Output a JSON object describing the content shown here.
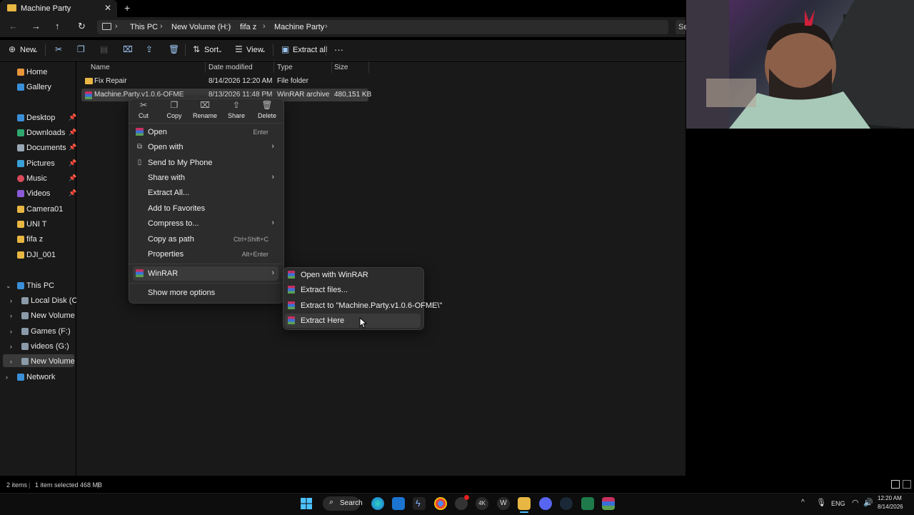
{
  "window": {
    "tab_title": "Machine Party",
    "tab_close": "✕",
    "new_tab": "+"
  },
  "nav": {
    "back": "←",
    "forward": "→",
    "up": "↑",
    "refresh": "↻"
  },
  "breadcrumb": {
    "items": [
      "This PC",
      "New Volume (H:)",
      "fifa z",
      "Machine Party"
    ],
    "chevron": "›",
    "search_stub": "Se"
  },
  "command_bar": {
    "new": "New",
    "sort": "Sort",
    "view": "View",
    "extract_all": "Extract all",
    "more": "···"
  },
  "sidebar": {
    "home": "Home",
    "gallery": "Gallery",
    "quick_access": [
      "Desktop",
      "Downloads",
      "Documents",
      "Pictures",
      "Music",
      "Videos",
      "Camera01",
      "UNI T",
      "fifa z",
      "DJI_001"
    ],
    "this_pc": "This PC",
    "drives": [
      "Local Disk (C:)",
      "New Volume (E:)",
      "Games (F:)",
      "videos (G:)",
      "New Volume (H:)"
    ],
    "network": "Network"
  },
  "file_list": {
    "headers": [
      "Name",
      "Date modified",
      "Type",
      "Size"
    ],
    "rows": [
      {
        "name": "Fix Repair",
        "date": "8/14/2026 12:20 AM",
        "type": "File folder",
        "size": ""
      },
      {
        "name": "Machine.Party.v1.0.6-OFME",
        "date": "8/13/2026 11:48 PM",
        "type": "WinRAR archive",
        "size": "480,151 KB"
      }
    ]
  },
  "status_bar": {
    "items": "2 items",
    "selected": "1 item selected  468 MB"
  },
  "context_menu": {
    "quick_actions": [
      "Cut",
      "Copy",
      "Rename",
      "Share",
      "Delete"
    ],
    "items": [
      {
        "label": "Open",
        "shortcut": "Enter"
      },
      {
        "label": "Open with",
        "shortcut": ""
      },
      {
        "label": "Send to My Phone",
        "shortcut": ""
      },
      {
        "label": "Share with",
        "shortcut": ""
      },
      {
        "label": "Extract All...",
        "shortcut": ""
      },
      {
        "label": "Add to Favorites",
        "shortcut": ""
      },
      {
        "label": "Compress to...",
        "shortcut": ""
      },
      {
        "label": "Copy as path",
        "shortcut": "Ctrl+Shift+C"
      },
      {
        "label": "Properties",
        "shortcut": "Alt+Enter"
      },
      {
        "label": "WinRAR",
        "shortcut": ""
      },
      {
        "label": "Show more options",
        "shortcut": ""
      }
    ]
  },
  "winrar_submenu": {
    "items": [
      "Open with WinRAR",
      "Extract files...",
      "Extract to \"Machine.Party.v1.0.6-OFME\\\"",
      "Extract Here"
    ]
  },
  "taskbar": {
    "search": "Search",
    "language": "ENG",
    "time": "12:20 AM",
    "date": "8/14/2026"
  },
  "colors": {
    "background": "#191919",
    "menu": "#2c2c2c",
    "folder": "#e8b642",
    "accent": "#4cc2ff"
  }
}
